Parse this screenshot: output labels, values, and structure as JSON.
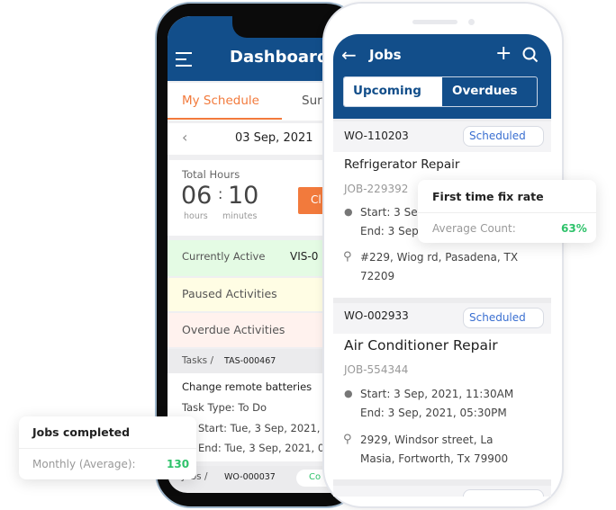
{
  "dashboard": {
    "title": "Dashboard",
    "menu_icon": "hamburger-icon",
    "tabs": [
      {
        "label": "My Schedule",
        "active": true
      },
      {
        "label": "Sur"
      }
    ],
    "date": "03 Sep, 2021",
    "total_hours_label": "Total Hours",
    "hours": "06",
    "minutes": "10",
    "hours_unit": "hours",
    "minutes_unit": "minutes",
    "clock_button": "Cl",
    "rows": [
      {
        "label": "Currently Active",
        "value": "VIS-0"
      },
      {
        "label": "Paused Activities"
      },
      {
        "label": "Overdue Activities"
      }
    ],
    "task": {
      "crumb": "Tasks /",
      "id": "TAS-000467",
      "title": "Change remote batteries",
      "type": "Task Type: To Do",
      "start": "Start: Tue, 3 Sep, 2021, 1",
      "end": "End: Tue, 3 Sep, 2021, 05"
    },
    "job": {
      "crumb": "Jobs /",
      "id": "WO-000037",
      "status": "Co"
    }
  },
  "jobs": {
    "title": "Jobs",
    "tabs": [
      {
        "label": "Upcoming",
        "active": true
      },
      {
        "label": "Overdues"
      }
    ],
    "items": [
      {
        "wo": "WO-110203",
        "status": "Scheduled",
        "title": "Refrigerator Repair",
        "job": "JOB-229392",
        "start": "Start: 3 Se",
        "end": "End: 3 Sep",
        "addr1": "#229, Wiog rd, Pasadena, TX",
        "addr2": "72209"
      },
      {
        "wo": "WO-002933",
        "status": "Scheduled",
        "title": "Air Conditioner Repair",
        "job": "JOB-554344",
        "start": "Start: 3 Sep, 2021, 11:30AM",
        "end": "End: 3 Sep, 2021, 05:30PM",
        "addr1": "2929, Windsor street, La",
        "addr2": "Masia, Fortworth, Tx 79900"
      }
    ]
  },
  "popups": {
    "fix_rate": {
      "title": "First time fix rate",
      "label": "Average Count:",
      "value": "63%"
    },
    "jobs_completed": {
      "title": "Jobs completed",
      "label": "Monthly (Average):",
      "value": "130"
    }
  },
  "colors": {
    "brand": "#124e8a",
    "accent": "#f27a3c",
    "positive": "#2ec26a"
  }
}
